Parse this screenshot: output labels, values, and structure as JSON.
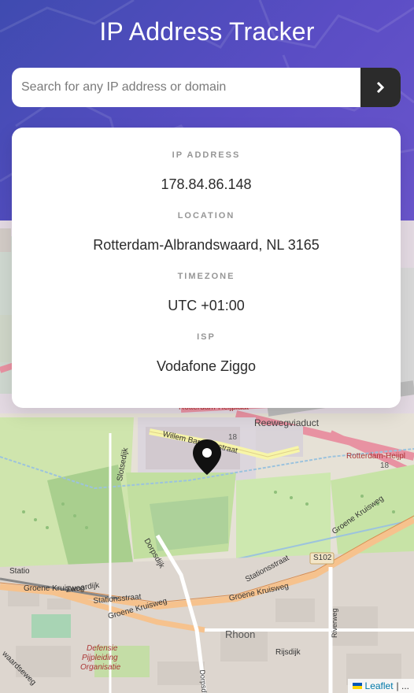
{
  "header": {
    "title": "IP Address Tracker",
    "search_placeholder": "Search for any IP address or domain",
    "search_value": "",
    "submit_icon": "chevron-right-icon"
  },
  "info": {
    "ip_label": "IP ADDRESS",
    "ip_value": "178.84.86.148",
    "location_label": "LOCATION",
    "location_value": "Rotterdam-Albrandswaard, NL 3165",
    "timezone_label": "TIMEZONE",
    "timezone_value": "UTC +01:00",
    "isp_label": "ISP",
    "isp_value": "Vodafone Ziggo"
  },
  "map": {
    "labels": {
      "reewegviaduct": "Reewegviaduct",
      "willem_barentszstraat": "Willem Barentszstraat",
      "rotterdam_heijplaat": "Rotterdam-Heijplaat",
      "rotterdam_heijplaat_right": "Rotterdam-Heijpl",
      "dorpsdijk": "Dorpsdijk",
      "slotsedijk": "Slotsedijk",
      "stationsstraat": "Stationsstraat",
      "stationsstraat_left": "Stationsstraat",
      "zwaardijk": "Zwaardijk",
      "groene_kruisweg_left": "Groene Kruisweg",
      "groene_kruisweg_mid": "Groene Kruisweg",
      "groene_kruisweg_right": "Groene Kruisweg",
      "groene_kruisweg_center": "Groene Kruisweg",
      "rhoon": "Rhoon",
      "rijsdijk": "Rijsdijk",
      "riverweg": "Riverweg",
      "s102": "S102",
      "route_18_a": "18",
      "route_18_b": "18",
      "defensie": "Defensie",
      "pijpleiding": "Pijpleiding",
      "organisatie": "Organisatie",
      "waardseweg": "waardseweg",
      "dorpsdijk_bottom": "Dorpsdijk",
      "statio": "Statio"
    },
    "attribution_link": "Leaflet",
    "attribution_rest": "| ..."
  },
  "colors": {
    "header_start": "#3f4bb0",
    "header_end": "#6a55cc",
    "button_dark": "#2b2b2b",
    "label_gray": "#969696",
    "value_dark": "#2b2b2b"
  }
}
